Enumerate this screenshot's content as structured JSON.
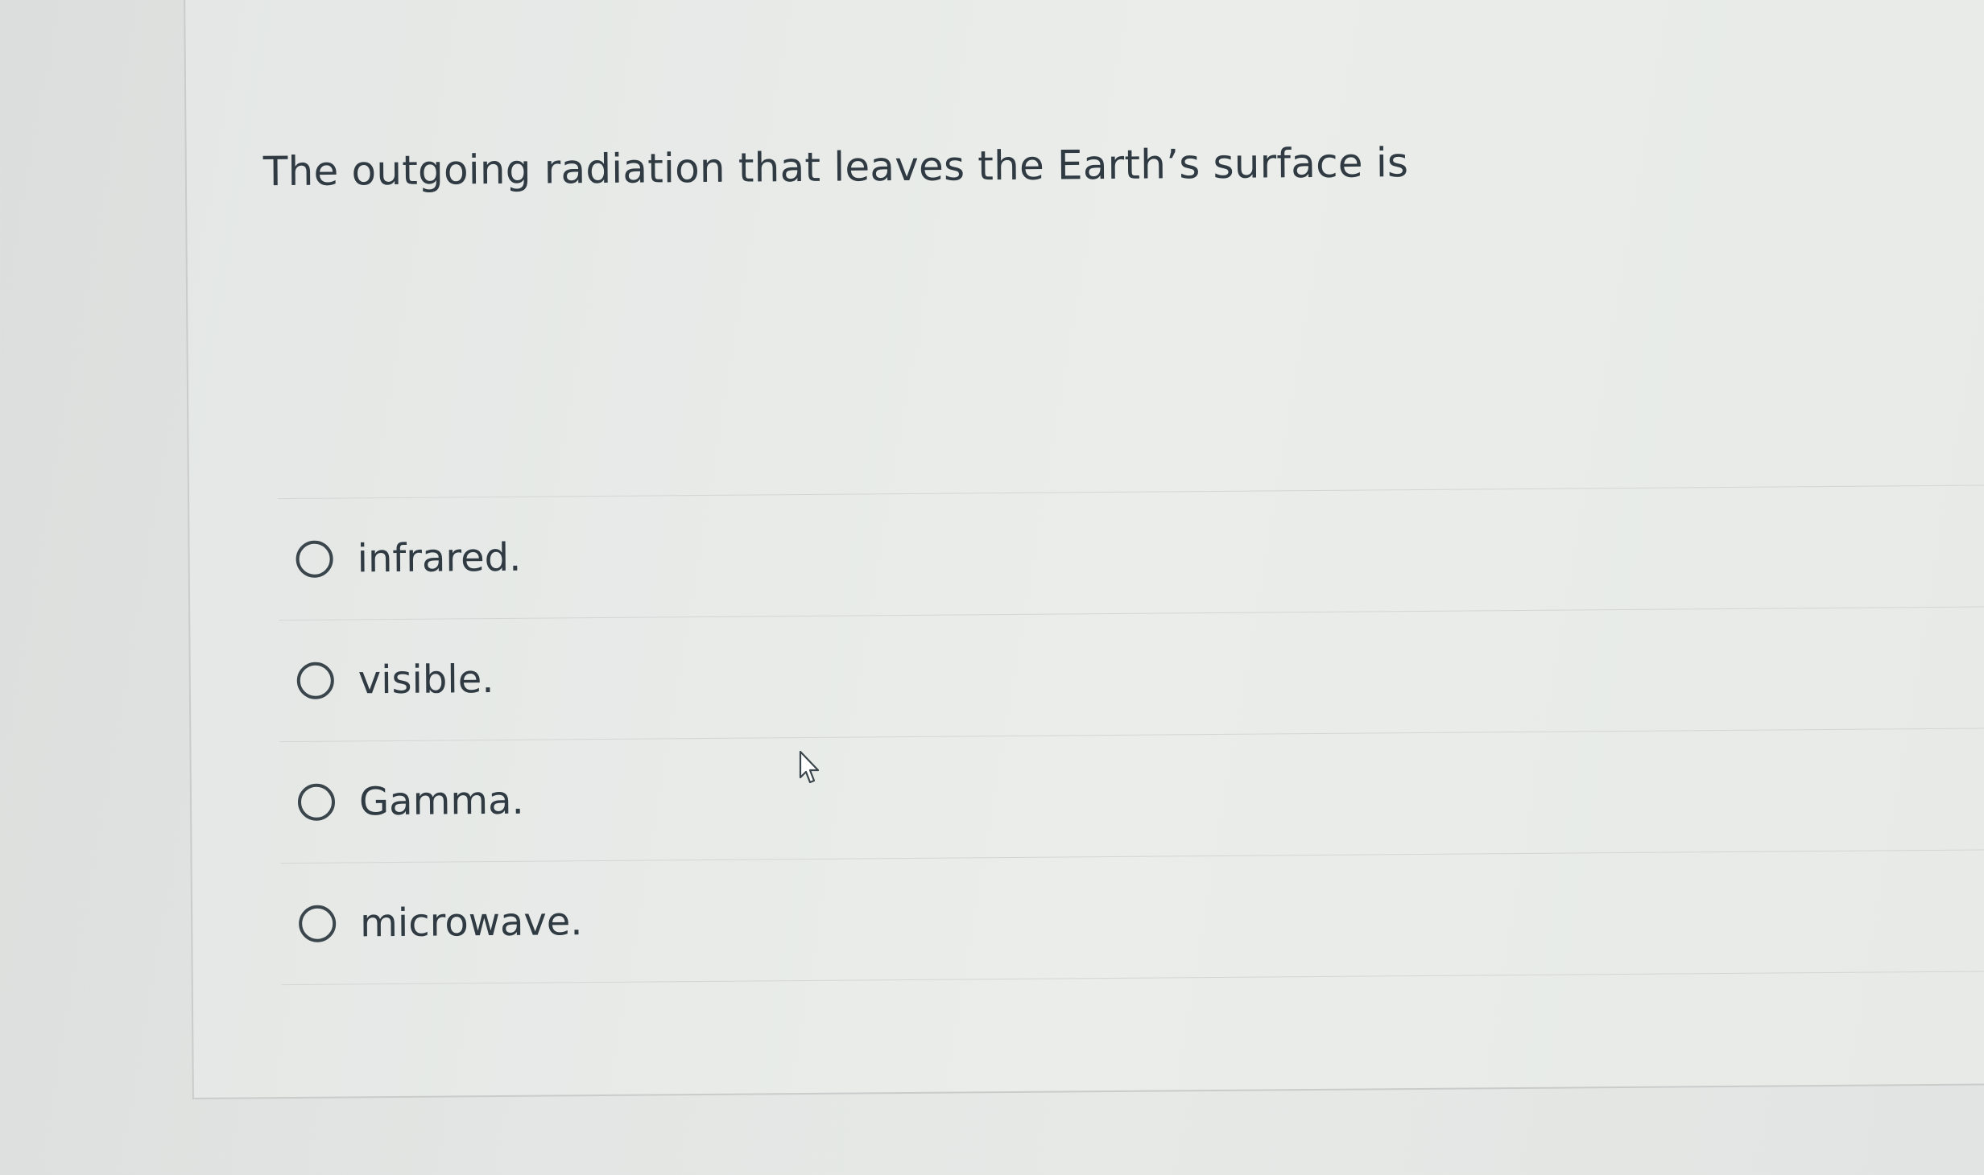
{
  "question": {
    "text": "The outgoing radiation that leaves the Earth’s surface is"
  },
  "answers": [
    {
      "label": "infrared.",
      "selected": false
    },
    {
      "label": "visible.",
      "selected": false
    },
    {
      "label": "Gamma.",
      "selected": false
    },
    {
      "label": "microwave.",
      "selected": false
    }
  ],
  "icons": {
    "radio": "radio-unchecked-icon",
    "cursor": "mouse-pointer-hand-icon"
  }
}
